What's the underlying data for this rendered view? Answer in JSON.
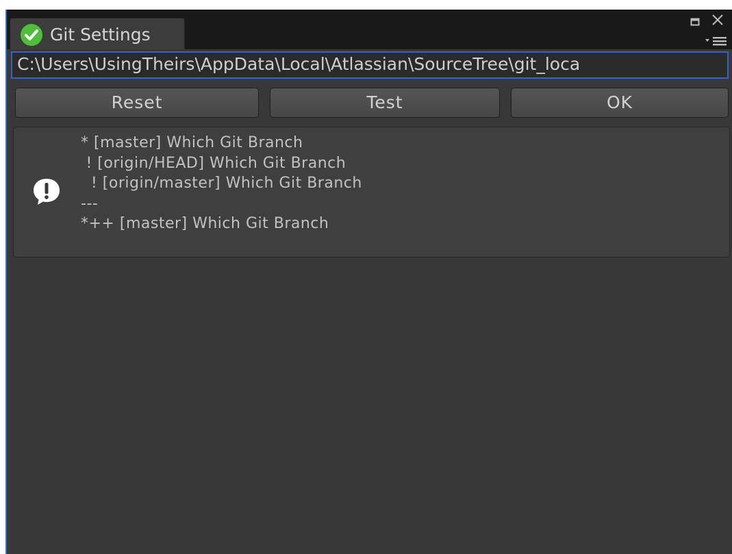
{
  "window": {
    "tab_title": "Git Settings",
    "tab_icon": "check-circle-icon",
    "controls": [
      "maximize-icon",
      "close-icon",
      "menu-icon"
    ]
  },
  "path_field": {
    "value": "C:\\Users\\UsingTheirs\\AppData\\Local\\Atlassian\\SourceTree\\git_loca"
  },
  "buttons": {
    "reset": "Reset",
    "test": "Test",
    "ok": "OK"
  },
  "info_box": {
    "icon": "exclamation-speech-icon",
    "lines": [
      "* [master] Which Git Branch",
      " ! [origin/HEAD] Which Git Branch",
      "  ! [origin/master] Which Git Branch",
      "---",
      "*++ [master] Which Git Branch"
    ]
  },
  "colors": {
    "background": "#383838",
    "tabstrip": "#191919",
    "accent_border": "#3b5ec7",
    "check_green": "#4fbf3a"
  }
}
